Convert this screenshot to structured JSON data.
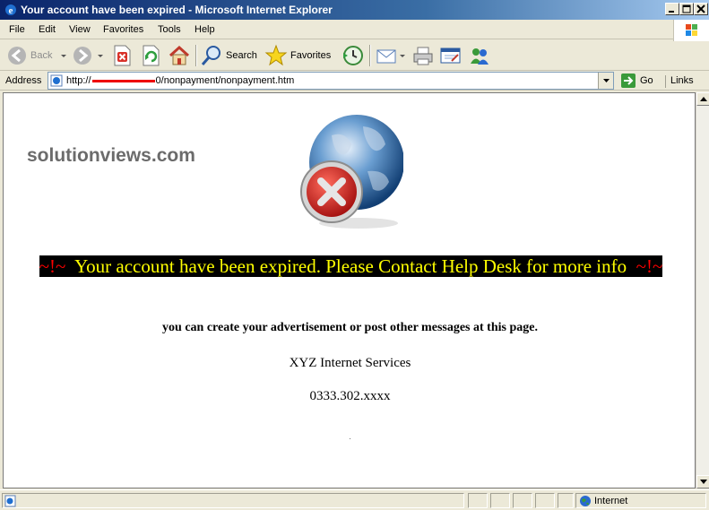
{
  "window": {
    "title": "Your account have been expired - Microsoft Internet Explorer"
  },
  "menu": [
    "File",
    "Edit",
    "View",
    "Favorites",
    "Tools",
    "Help"
  ],
  "toolbar": {
    "back_label": "Back",
    "search_label": "Search",
    "favorites_label": "Favorites"
  },
  "address": {
    "label": "Address",
    "url_prefix": "http://",
    "url_suffix": "0/nonpayment/nonpayment.htm",
    "go_label": "Go",
    "links_label": "Links"
  },
  "page": {
    "site_name": "solutionviews.com",
    "banner_tilde_left": "~!~",
    "banner_text": "Your account have been expired. Please Contact Help Desk for more info",
    "banner_tilde_right": "~!~",
    "line1": "you can create your advertisement or post other messages at this page.",
    "line2": "XYZ Internet Services",
    "line3": "0333.302.xxxx"
  },
  "status": {
    "zone_label": "Internet"
  },
  "colors": {
    "banner_bg": "#000000",
    "banner_text": "#ffff00",
    "banner_tilde": "#ff0000",
    "site_name": "#6b6b6b"
  }
}
